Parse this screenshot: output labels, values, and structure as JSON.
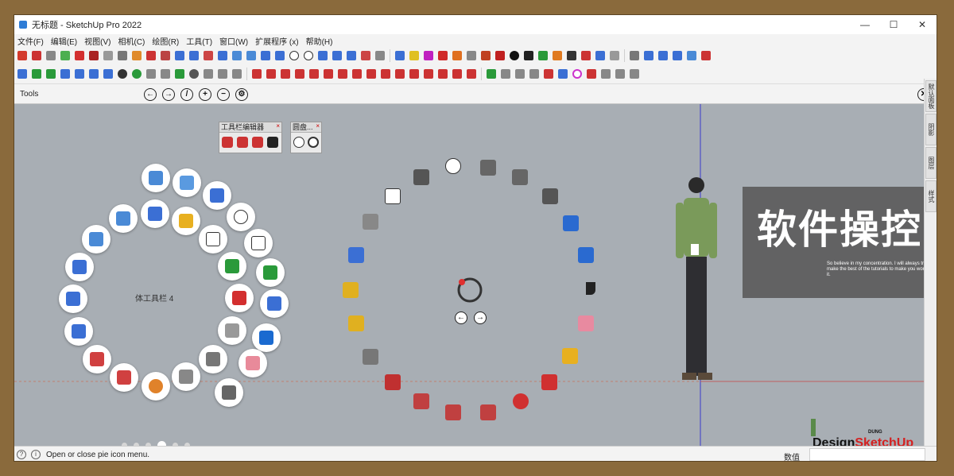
{
  "window": {
    "title": "无标题 - SketchUp Pro 2022",
    "minimize": "—",
    "maximize": "☐",
    "close": "✕"
  },
  "menu": [
    "文件(F)",
    "编辑(E)",
    "视图(V)",
    "相机(C)",
    "绘图(R)",
    "工具(T)",
    "窗口(W)",
    "扩展程序 (x)",
    "帮助(H)"
  ],
  "tools_bar": {
    "label": "Tools",
    "close": "✕"
  },
  "floating_panels": [
    {
      "title": "工具栏编辑器",
      "close": "×"
    },
    {
      "title": "圆盘...",
      "close": "×"
    }
  ],
  "pie_menu": {
    "label": "体工具栏 4"
  },
  "overlay": {
    "title": "软件操控",
    "subtitle": "So believe in my concentration. I will always try to make the best of the tutorials to make you worth it."
  },
  "status": {
    "text": "Open or close pie icon menu.",
    "measure_label": "数值",
    "measure_value": ""
  },
  "side_tabs": [
    "默认面板",
    "阴影",
    "图层",
    "样式"
  ],
  "watermark": {
    "prefix": "Design",
    "brand": "SketchUp",
    "tag": "DUNG"
  },
  "page_dots": {
    "count": 6,
    "active": 3
  },
  "colors": {
    "frame_bg": "#8a6a3c",
    "viewport_bg": "#a8aeb4",
    "banner_bg": "#585858",
    "accent_red": "#d42020"
  }
}
